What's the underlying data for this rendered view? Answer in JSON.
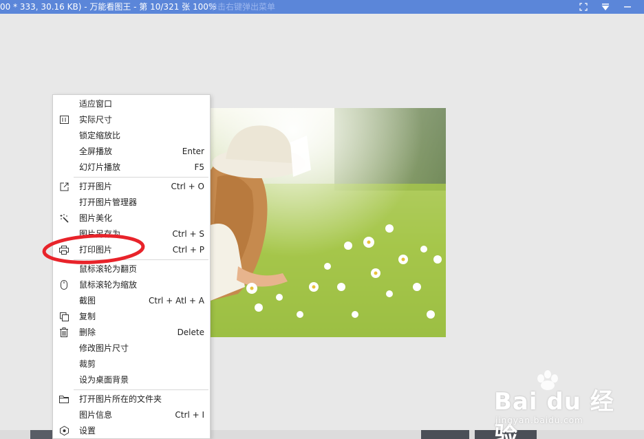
{
  "window": {
    "title": "00 * 333, 30.16 KB) - 万能看图王 - 第 10/321 张 100%",
    "ghost_text": "单击右键弹出菜单",
    "controls": {
      "fullscreen_icon": "fit-screen-icon",
      "dropdown_icon": "dropdown-arrow-icon",
      "minimize_icon": "minimize-icon"
    }
  },
  "image": {
    "subject": "girl-in-flower-meadow-photo"
  },
  "context_menu": {
    "items": [
      {
        "label": "适应窗口",
        "shortcut": "",
        "icon": ""
      },
      {
        "label": "实际尺寸",
        "shortcut": "",
        "icon": "actual-size-icon"
      },
      {
        "label": "锁定缩放比",
        "shortcut": "",
        "icon": ""
      },
      {
        "label": "全屏播放",
        "shortcut": "Enter",
        "icon": ""
      },
      {
        "label": "幻灯片播放",
        "shortcut": "F5",
        "icon": ""
      },
      {
        "label": "打开图片",
        "shortcut": "Ctrl + O",
        "icon": "open-external-icon"
      },
      {
        "label": "打开图片管理器",
        "shortcut": "",
        "icon": ""
      },
      {
        "label": "图片美化",
        "shortcut": "",
        "icon": "magic-wand-icon"
      },
      {
        "label": "图片另存为",
        "shortcut": "Ctrl + S",
        "icon": ""
      },
      {
        "label": "打印图片",
        "shortcut": "Ctrl + P",
        "icon": "printer-icon"
      },
      {
        "label": "鼠标滚轮为翻页",
        "shortcut": "",
        "icon": ""
      },
      {
        "label": "鼠标滚轮为缩放",
        "shortcut": "",
        "icon": "mouse-icon"
      },
      {
        "label": "截图",
        "shortcut": "Ctrl + Atl + A",
        "icon": ""
      },
      {
        "label": "复制",
        "shortcut": "",
        "icon": "copy-icon"
      },
      {
        "label": "删除",
        "shortcut": "Delete",
        "icon": "trash-icon"
      },
      {
        "label": "修改图片尺寸",
        "shortcut": "",
        "icon": ""
      },
      {
        "label": "裁剪",
        "shortcut": "",
        "icon": ""
      },
      {
        "label": "设为桌面背景",
        "shortcut": "",
        "icon": ""
      },
      {
        "label": "打开图片所在的文件夹",
        "shortcut": "",
        "icon": "folder-icon"
      },
      {
        "label": "图片信息",
        "shortcut": "Ctrl + I",
        "icon": ""
      },
      {
        "label": "设置",
        "shortcut": "",
        "icon": "settings-icon"
      }
    ],
    "highlight": {
      "item": "打印图片",
      "mark_color": "#e8232a"
    }
  },
  "watermark": {
    "logo": "Bai  du 经验",
    "url": "jingyan.baidu.com"
  },
  "colors": {
    "titlebar": "#5b86d9",
    "background": "#e8e8e8",
    "highlight_ring": "#e8232a"
  }
}
